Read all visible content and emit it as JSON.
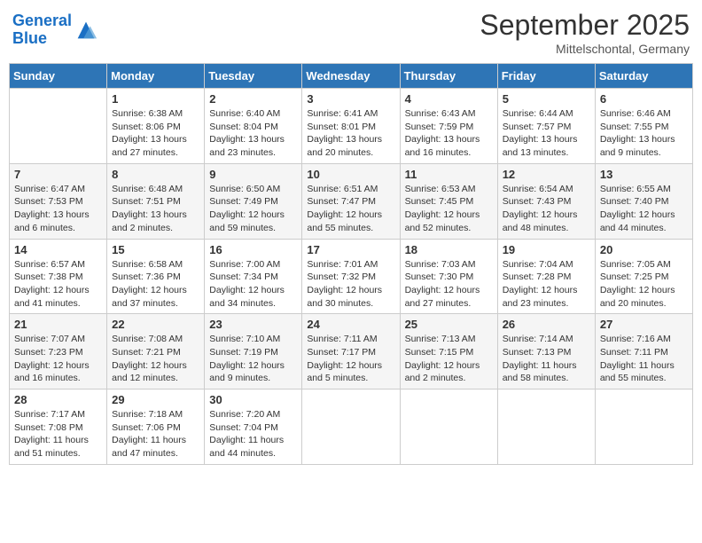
{
  "logo": {
    "line1": "General",
    "line2": "Blue"
  },
  "title": "September 2025",
  "subtitle": "Mittelschontal, Germany",
  "days_of_week": [
    "Sunday",
    "Monday",
    "Tuesday",
    "Wednesday",
    "Thursday",
    "Friday",
    "Saturday"
  ],
  "weeks": [
    [
      {
        "day": "",
        "info": ""
      },
      {
        "day": "1",
        "info": "Sunrise: 6:38 AM\nSunset: 8:06 PM\nDaylight: 13 hours\nand 27 minutes."
      },
      {
        "day": "2",
        "info": "Sunrise: 6:40 AM\nSunset: 8:04 PM\nDaylight: 13 hours\nand 23 minutes."
      },
      {
        "day": "3",
        "info": "Sunrise: 6:41 AM\nSunset: 8:01 PM\nDaylight: 13 hours\nand 20 minutes."
      },
      {
        "day": "4",
        "info": "Sunrise: 6:43 AM\nSunset: 7:59 PM\nDaylight: 13 hours\nand 16 minutes."
      },
      {
        "day": "5",
        "info": "Sunrise: 6:44 AM\nSunset: 7:57 PM\nDaylight: 13 hours\nand 13 minutes."
      },
      {
        "day": "6",
        "info": "Sunrise: 6:46 AM\nSunset: 7:55 PM\nDaylight: 13 hours\nand 9 minutes."
      }
    ],
    [
      {
        "day": "7",
        "info": "Sunrise: 6:47 AM\nSunset: 7:53 PM\nDaylight: 13 hours\nand 6 minutes."
      },
      {
        "day": "8",
        "info": "Sunrise: 6:48 AM\nSunset: 7:51 PM\nDaylight: 13 hours\nand 2 minutes."
      },
      {
        "day": "9",
        "info": "Sunrise: 6:50 AM\nSunset: 7:49 PM\nDaylight: 12 hours\nand 59 minutes."
      },
      {
        "day": "10",
        "info": "Sunrise: 6:51 AM\nSunset: 7:47 PM\nDaylight: 12 hours\nand 55 minutes."
      },
      {
        "day": "11",
        "info": "Sunrise: 6:53 AM\nSunset: 7:45 PM\nDaylight: 12 hours\nand 52 minutes."
      },
      {
        "day": "12",
        "info": "Sunrise: 6:54 AM\nSunset: 7:43 PM\nDaylight: 12 hours\nand 48 minutes."
      },
      {
        "day": "13",
        "info": "Sunrise: 6:55 AM\nSunset: 7:40 PM\nDaylight: 12 hours\nand 44 minutes."
      }
    ],
    [
      {
        "day": "14",
        "info": "Sunrise: 6:57 AM\nSunset: 7:38 PM\nDaylight: 12 hours\nand 41 minutes."
      },
      {
        "day": "15",
        "info": "Sunrise: 6:58 AM\nSunset: 7:36 PM\nDaylight: 12 hours\nand 37 minutes."
      },
      {
        "day": "16",
        "info": "Sunrise: 7:00 AM\nSunset: 7:34 PM\nDaylight: 12 hours\nand 34 minutes."
      },
      {
        "day": "17",
        "info": "Sunrise: 7:01 AM\nSunset: 7:32 PM\nDaylight: 12 hours\nand 30 minutes."
      },
      {
        "day": "18",
        "info": "Sunrise: 7:03 AM\nSunset: 7:30 PM\nDaylight: 12 hours\nand 27 minutes."
      },
      {
        "day": "19",
        "info": "Sunrise: 7:04 AM\nSunset: 7:28 PM\nDaylight: 12 hours\nand 23 minutes."
      },
      {
        "day": "20",
        "info": "Sunrise: 7:05 AM\nSunset: 7:25 PM\nDaylight: 12 hours\nand 20 minutes."
      }
    ],
    [
      {
        "day": "21",
        "info": "Sunrise: 7:07 AM\nSunset: 7:23 PM\nDaylight: 12 hours\nand 16 minutes."
      },
      {
        "day": "22",
        "info": "Sunrise: 7:08 AM\nSunset: 7:21 PM\nDaylight: 12 hours\nand 12 minutes."
      },
      {
        "day": "23",
        "info": "Sunrise: 7:10 AM\nSunset: 7:19 PM\nDaylight: 12 hours\nand 9 minutes."
      },
      {
        "day": "24",
        "info": "Sunrise: 7:11 AM\nSunset: 7:17 PM\nDaylight: 12 hours\nand 5 minutes."
      },
      {
        "day": "25",
        "info": "Sunrise: 7:13 AM\nSunset: 7:15 PM\nDaylight: 12 hours\nand 2 minutes."
      },
      {
        "day": "26",
        "info": "Sunrise: 7:14 AM\nSunset: 7:13 PM\nDaylight: 11 hours\nand 58 minutes."
      },
      {
        "day": "27",
        "info": "Sunrise: 7:16 AM\nSunset: 7:11 PM\nDaylight: 11 hours\nand 55 minutes."
      }
    ],
    [
      {
        "day": "28",
        "info": "Sunrise: 7:17 AM\nSunset: 7:08 PM\nDaylight: 11 hours\nand 51 minutes."
      },
      {
        "day": "29",
        "info": "Sunrise: 7:18 AM\nSunset: 7:06 PM\nDaylight: 11 hours\nand 47 minutes."
      },
      {
        "day": "30",
        "info": "Sunrise: 7:20 AM\nSunset: 7:04 PM\nDaylight: 11 hours\nand 44 minutes."
      },
      {
        "day": "",
        "info": ""
      },
      {
        "day": "",
        "info": ""
      },
      {
        "day": "",
        "info": ""
      },
      {
        "day": "",
        "info": ""
      }
    ]
  ]
}
